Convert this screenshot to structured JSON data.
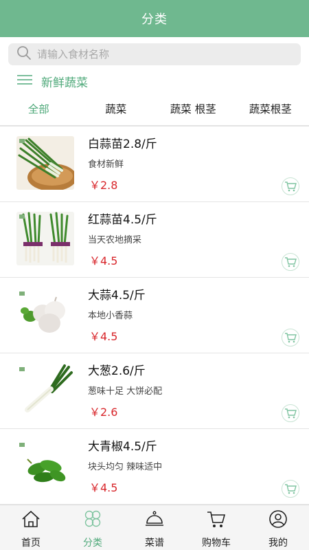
{
  "header": {
    "title": "分类"
  },
  "search": {
    "placeholder": "请输入食材名称",
    "icon": "search-icon"
  },
  "category": {
    "icon": "menu-icon",
    "title": "新鲜蔬菜"
  },
  "tabs": [
    {
      "label": "全部",
      "active": true
    },
    {
      "label": "蔬菜",
      "active": false
    },
    {
      "label": "蔬菜 根茎",
      "active": false
    },
    {
      "label": "蔬菜根茎",
      "active": false
    }
  ],
  "products": [
    {
      "name": "白蒜苗2.8/斤",
      "desc": "食材新鲜",
      "price": "￥2.8",
      "image": "scallion-basket-photo"
    },
    {
      "name": "红蒜苗4.5/斤",
      "desc": "当天农地摘采",
      "price": "￥4.5",
      "image": "garlic-sprouts-bundle-photo"
    },
    {
      "name": "大蒜4.5/斤",
      "desc": "本地小香蒜",
      "price": "￥4.5",
      "image": "garlic-bulbs-photo"
    },
    {
      "name": "大葱2.6/斤",
      "desc": "葱味十足 大饼必配",
      "price": "￥2.6",
      "image": "leek-photo"
    },
    {
      "name": "大青椒4.5/斤",
      "desc": "块头均匀 辣味适中",
      "price": "￥4.5",
      "image": "green-peppers-photo"
    }
  ],
  "bottom_nav": [
    {
      "label": "首页",
      "icon": "home-icon",
      "active": false
    },
    {
      "label": "分类",
      "icon": "category-icon",
      "active": true
    },
    {
      "label": "菜谱",
      "icon": "recipe-cloche-icon",
      "active": false
    },
    {
      "label": "购物车",
      "icon": "cart-icon",
      "active": false
    },
    {
      "label": "我的",
      "icon": "profile-icon",
      "active": false
    }
  ],
  "colors": {
    "brand": "#6fb88f",
    "accent": "#4fa97a",
    "price": "#d8262b"
  }
}
